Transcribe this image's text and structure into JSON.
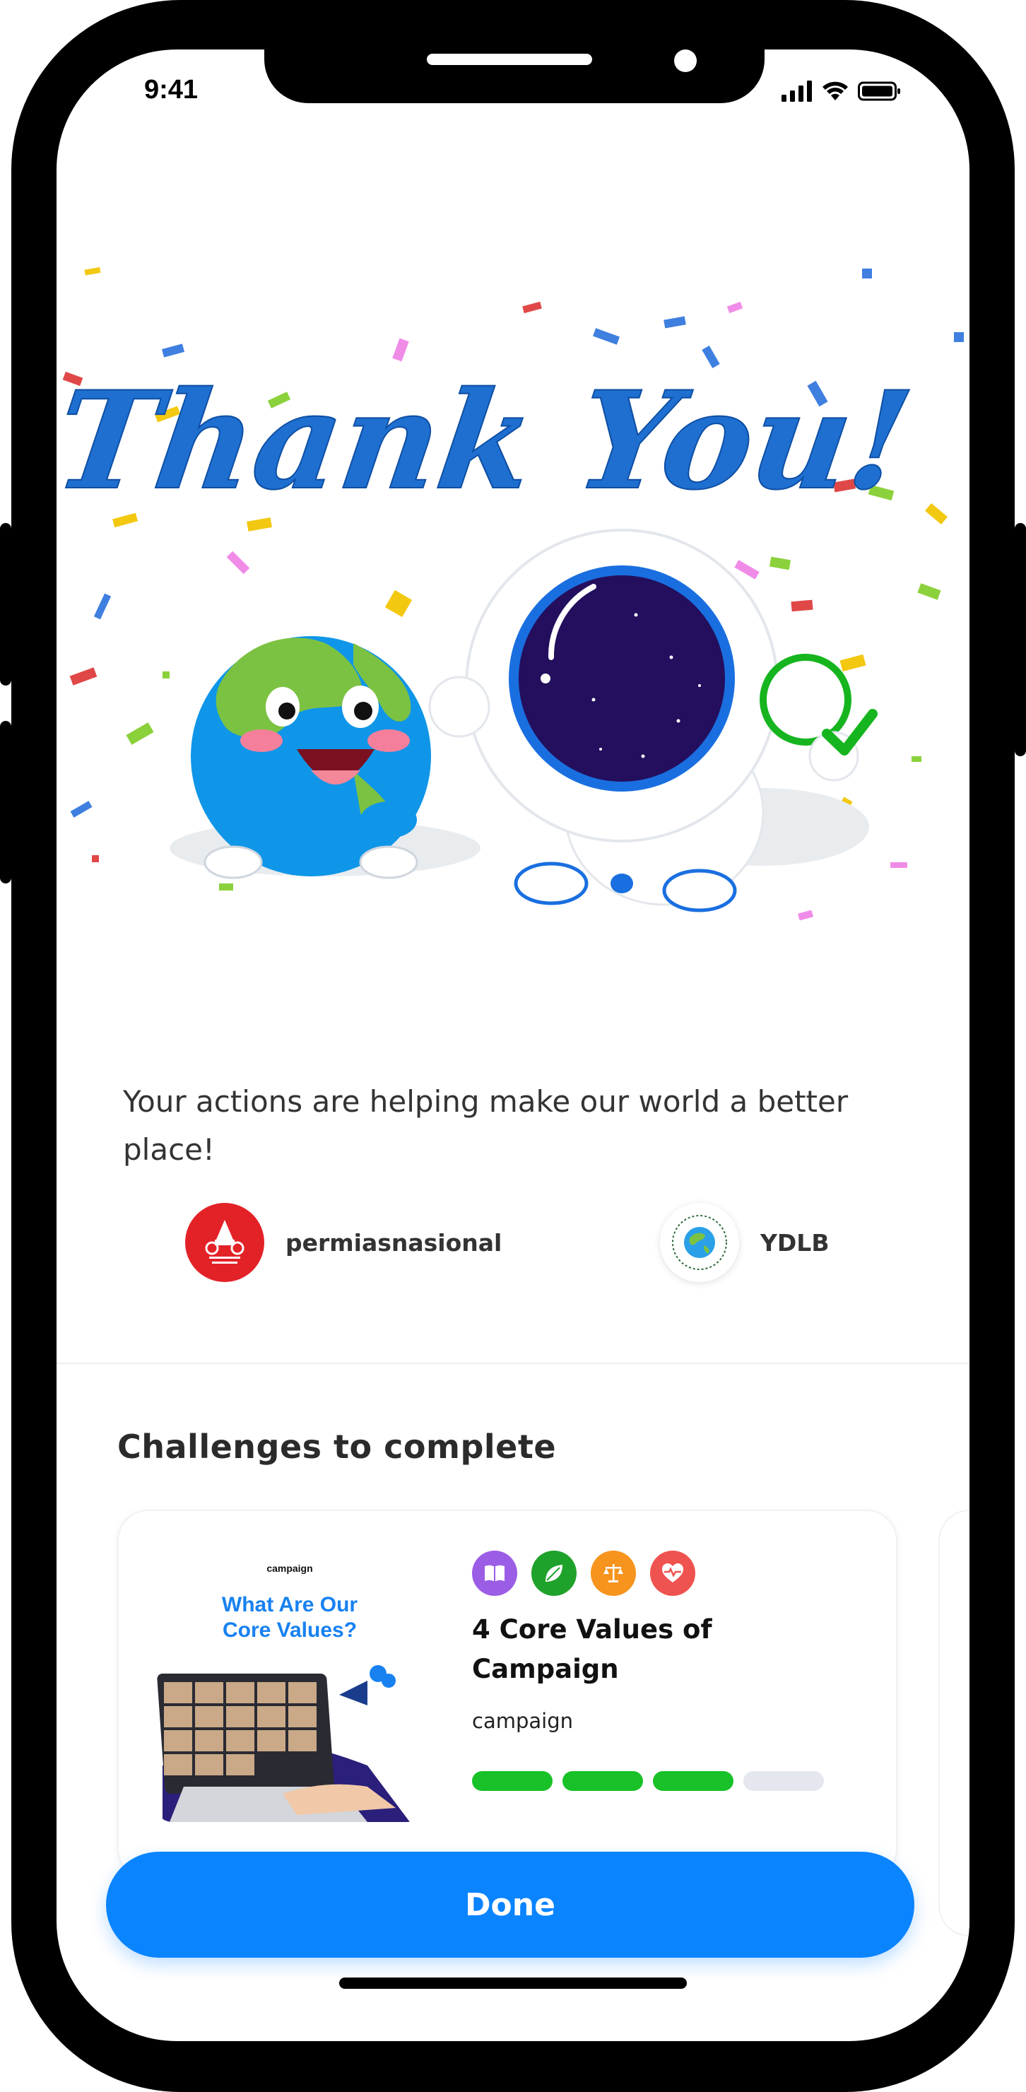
{
  "status_bar": {
    "time": "9:41"
  },
  "hero": {
    "headline": "Thank You!"
  },
  "message": "Your actions are helping make our world a better place!",
  "organizations": [
    {
      "name": "permiasnasional",
      "logo_text": "PERMIAS NASIONAL"
    },
    {
      "name": "YDLB"
    }
  ],
  "challenges": {
    "section_title": "Challenges to complete",
    "cards": [
      {
        "thumbnail": {
          "brand": "campaign",
          "headline_line1": "What Are Our",
          "headline_line2": "Core Values?"
        },
        "title": "4 Core Values of Campaign",
        "org": "campaign",
        "categories": [
          "book-icon",
          "leaf-icon",
          "scales-icon",
          "heart-pulse-icon"
        ],
        "progress": {
          "completed": 3,
          "total": 4
        }
      }
    ]
  },
  "footer": {
    "done_label": "Done"
  },
  "colors": {
    "primary": "#0a84ff",
    "progress_done": "#18c127",
    "progress_todo": "#e4e8ee",
    "cat_purple": "#9b5de5",
    "cat_green": "#1fa22b",
    "cat_orange": "#f7941d",
    "cat_red": "#ef5350"
  }
}
